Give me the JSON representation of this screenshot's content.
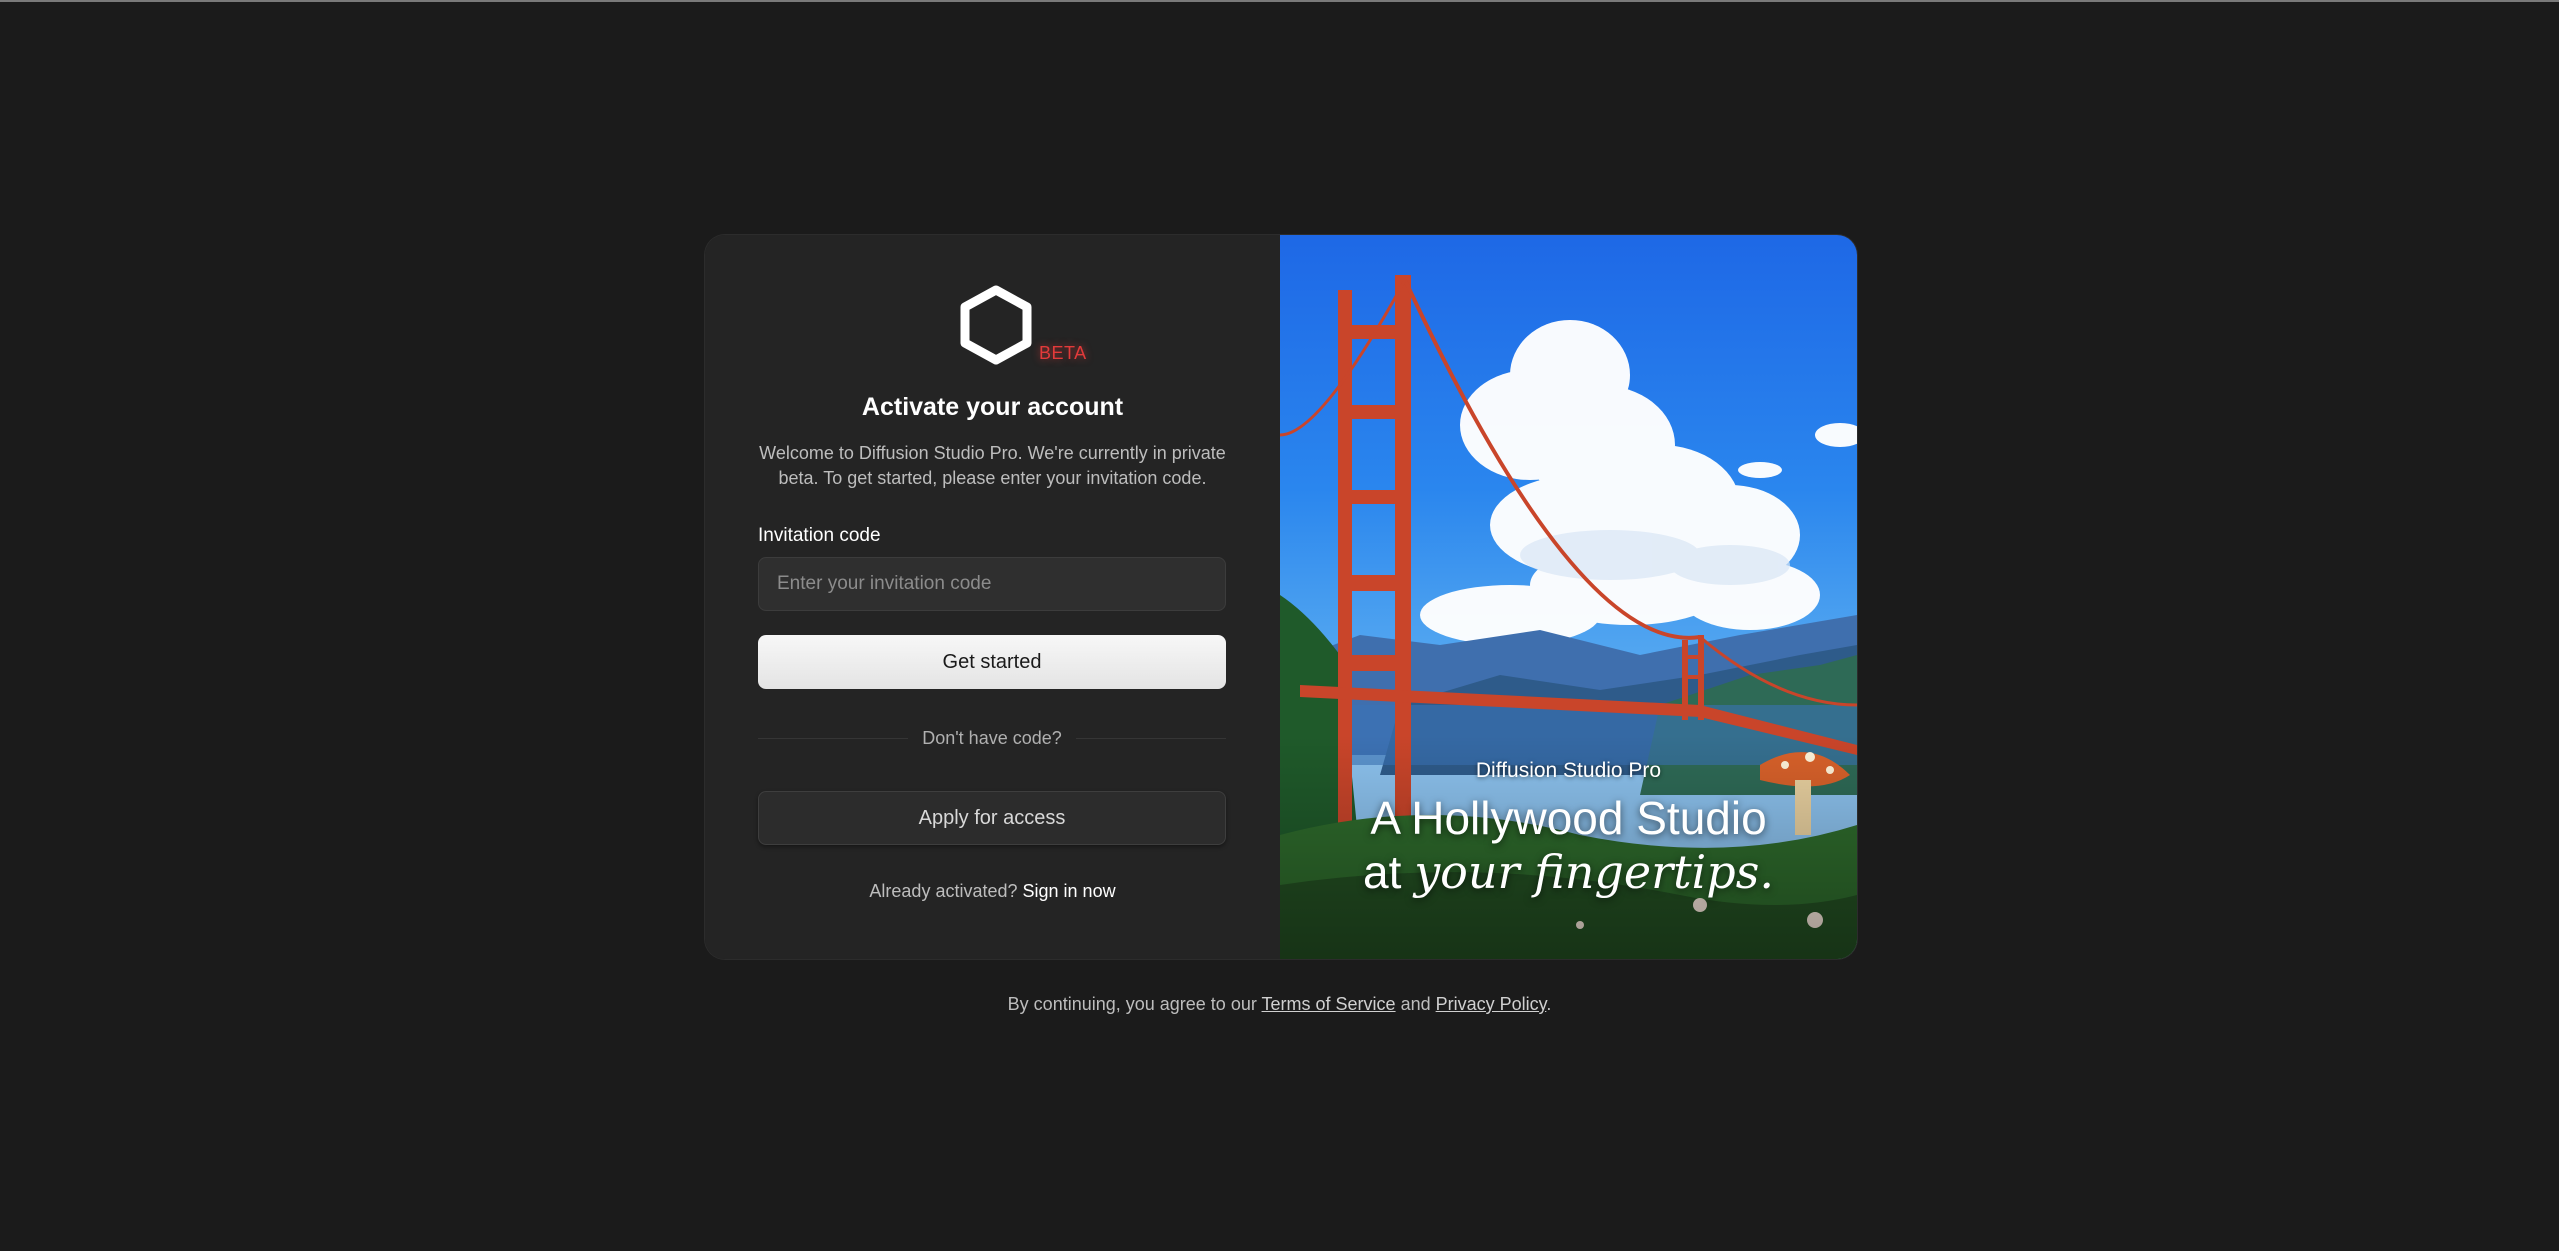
{
  "app": {
    "beta_badge": "BETA",
    "title": "Activate your account",
    "subtitle": "Welcome to Diffusion Studio Pro. We're currently in private beta. To get started, please enter your invitation code."
  },
  "form": {
    "invitation_label": "Invitation code",
    "invitation_value": "",
    "invitation_placeholder": "Enter your invitation code",
    "submit_label": "Get started",
    "divider_text": "Don't have code?",
    "apply_label": "Apply for access",
    "already_text": "Already activated?",
    "signin_label": "Sign in now"
  },
  "hero": {
    "brand": "Diffusion Studio Pro",
    "headline_line1": "A Hollywood Studio",
    "headline_line2_prefix": "at ",
    "headline_line2_italic": "your fingertips."
  },
  "footer": {
    "prefix": "By continuing, you agree to our ",
    "terms_label": "Terms of Service",
    "and": " and ",
    "privacy_label": "Privacy Policy",
    "suffix": "."
  },
  "colors": {
    "background": "#1b1b1b",
    "panel": "#242424",
    "beta": "#e23a3a",
    "primary_button": "#f0f0f0"
  },
  "icons": {
    "logo": "hexagon-logo-icon"
  }
}
